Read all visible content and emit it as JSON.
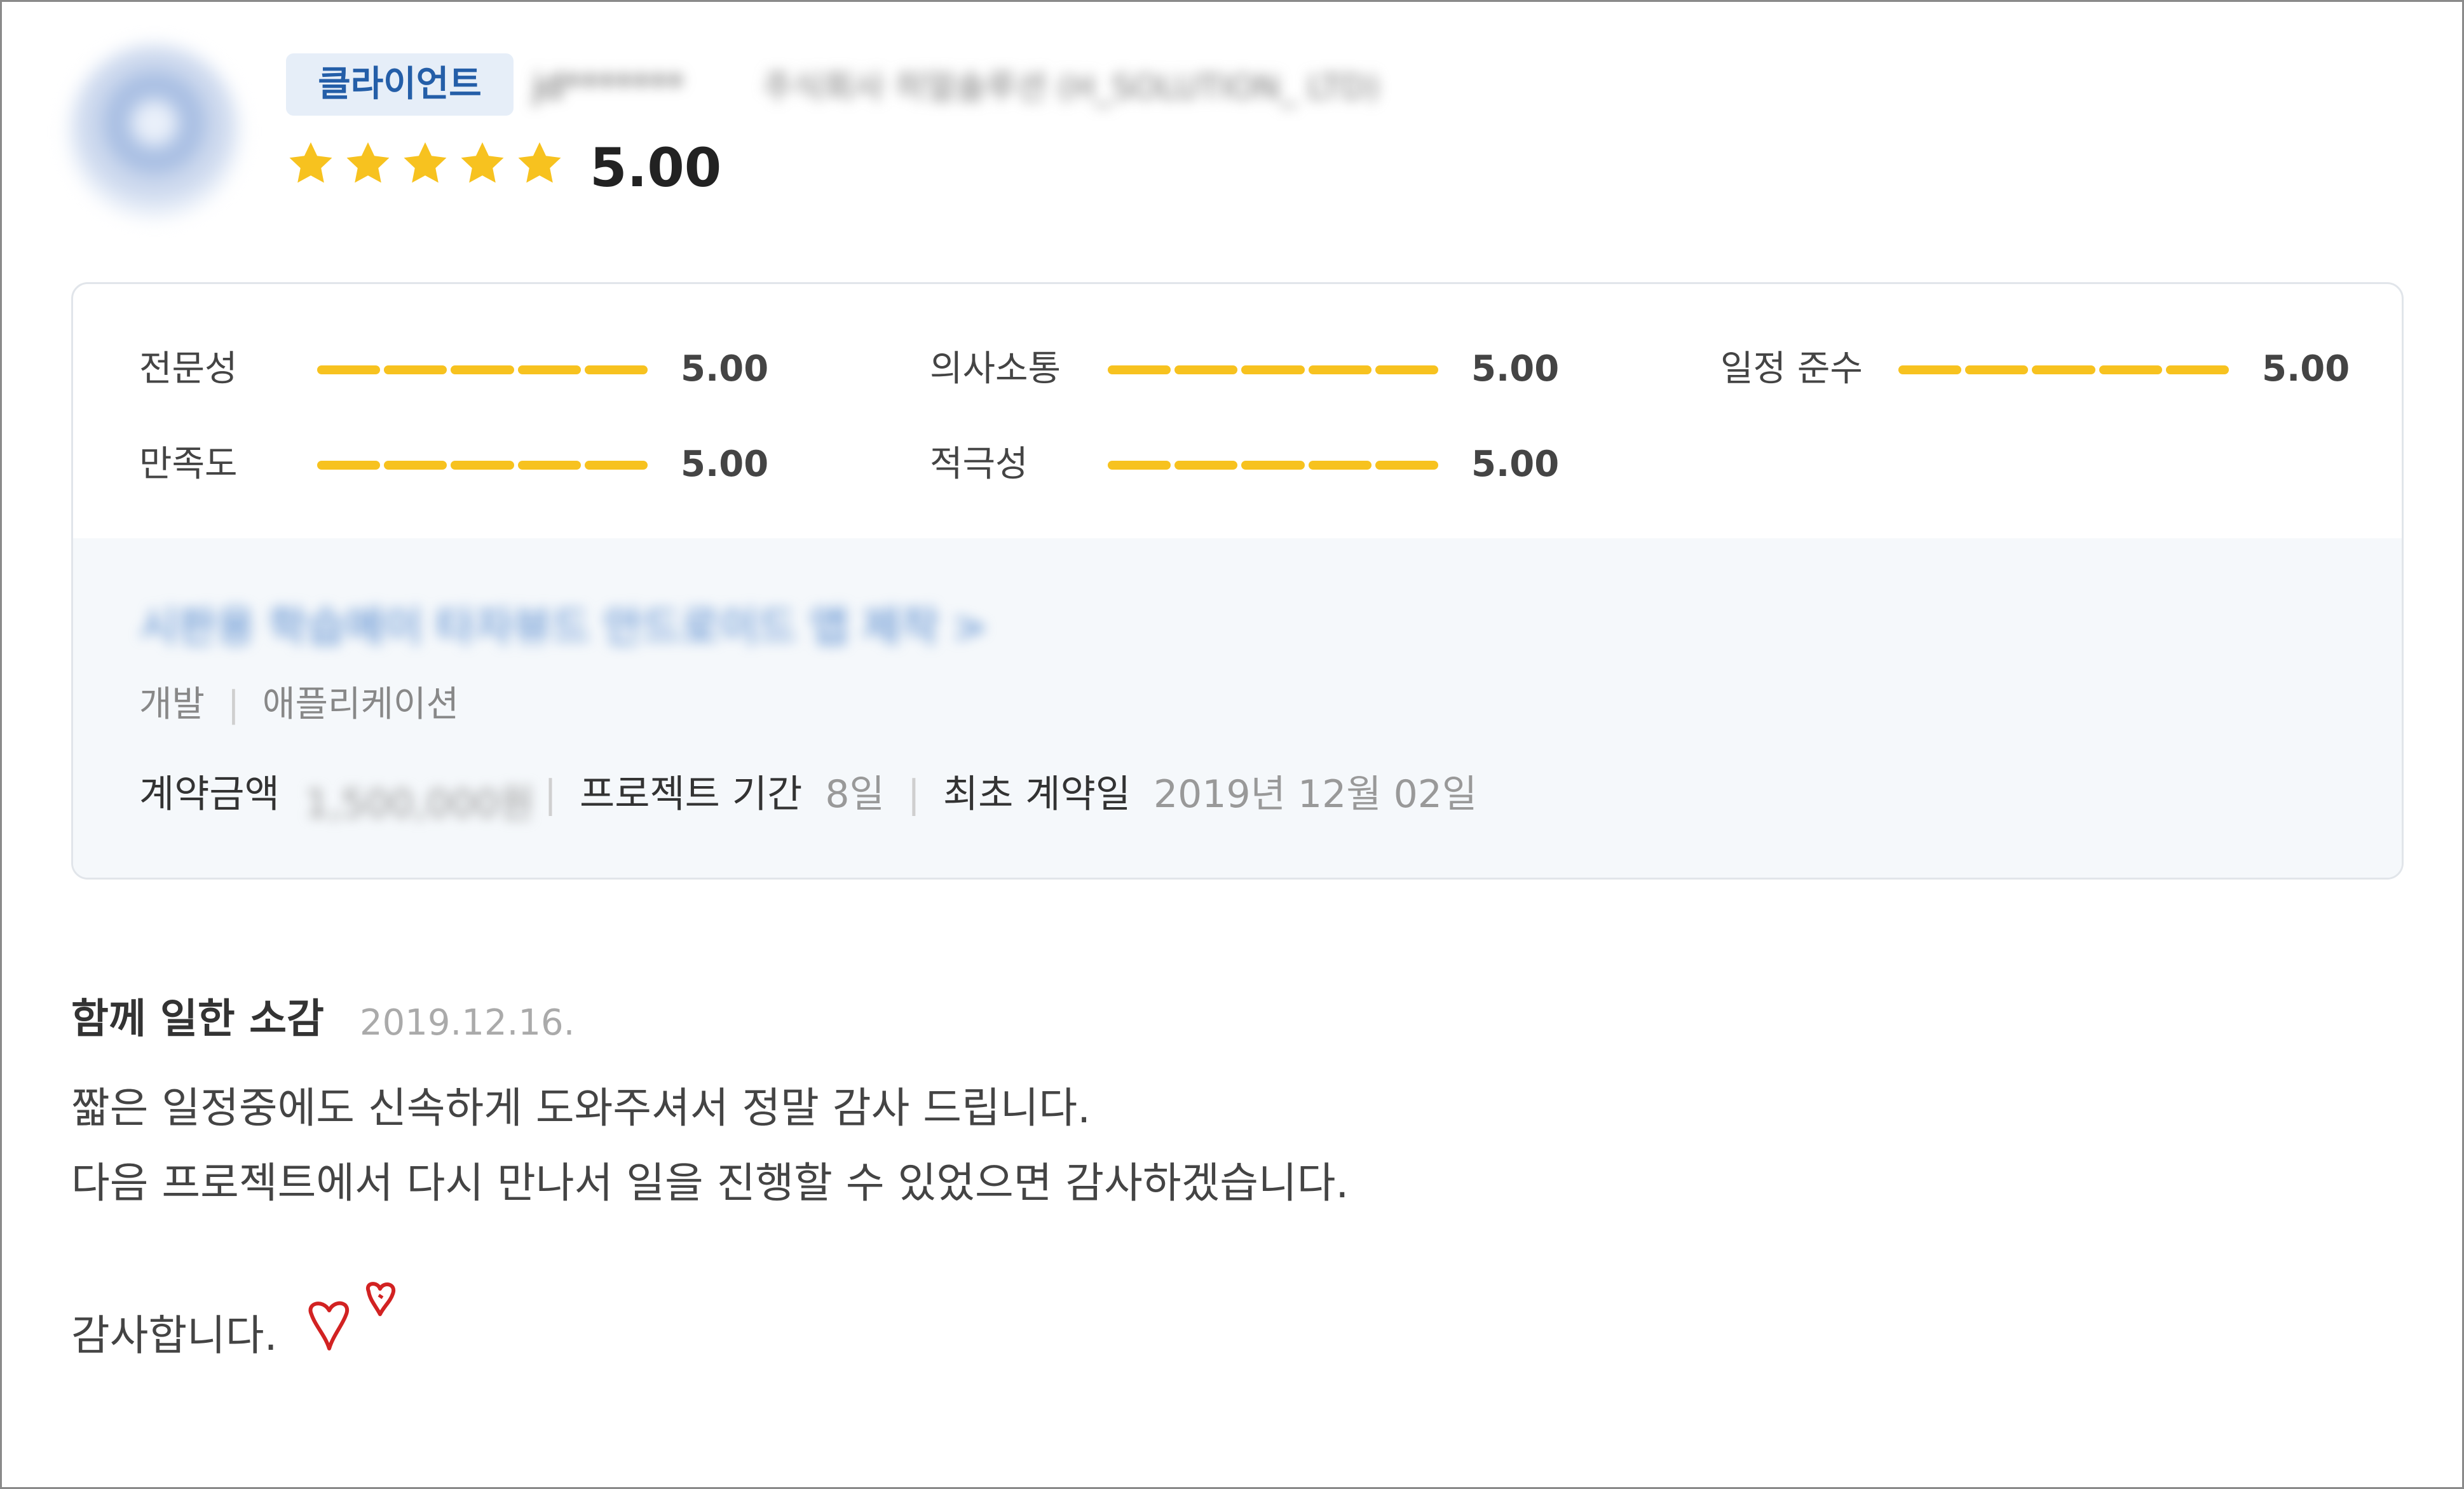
{
  "header": {
    "badge": "클라이언트",
    "name": "jd*******",
    "company": "주식회사 히얼솔루션 (H_SOLUTION_ LTD)",
    "rating": "5.00",
    "stars": 5
  },
  "metrics": [
    {
      "label": "전문성",
      "value": "5.00"
    },
    {
      "label": "의사소통",
      "value": "5.00"
    },
    {
      "label": "일정 준수",
      "value": "5.00"
    },
    {
      "label": "만족도",
      "value": "5.00"
    },
    {
      "label": "적극성",
      "value": "5.00"
    }
  ],
  "project": {
    "title": "시판용 학습메이 타자뷰드 안드로이드 앱 제작 >",
    "category": "개발",
    "subcategory": "애플리케이션",
    "amount_label": "계약금액",
    "amount_value": "1,500,000원",
    "period_label": "프로젝트 기간",
    "period_value": "8일",
    "first_contract_label": "최초 계약일",
    "first_contract_value": "2019년 12월 02일"
  },
  "review": {
    "heading": "함께 일한 소감",
    "date": "2019.12.16.",
    "lines": [
      "짧은 일정중에도 신속하게 도와주셔서 정말 감사 드립니다.",
      "다음 프로젝트에서 다시 만나서 일을 진행할 수 있었으면 감사하겠습니다.",
      "감사합니다."
    ]
  },
  "colors": {
    "accent_star": "#f7c21f",
    "badge_bg": "#e6eef8",
    "badge_text": "#245ea8",
    "panel_bg": "#f5f8fb"
  }
}
